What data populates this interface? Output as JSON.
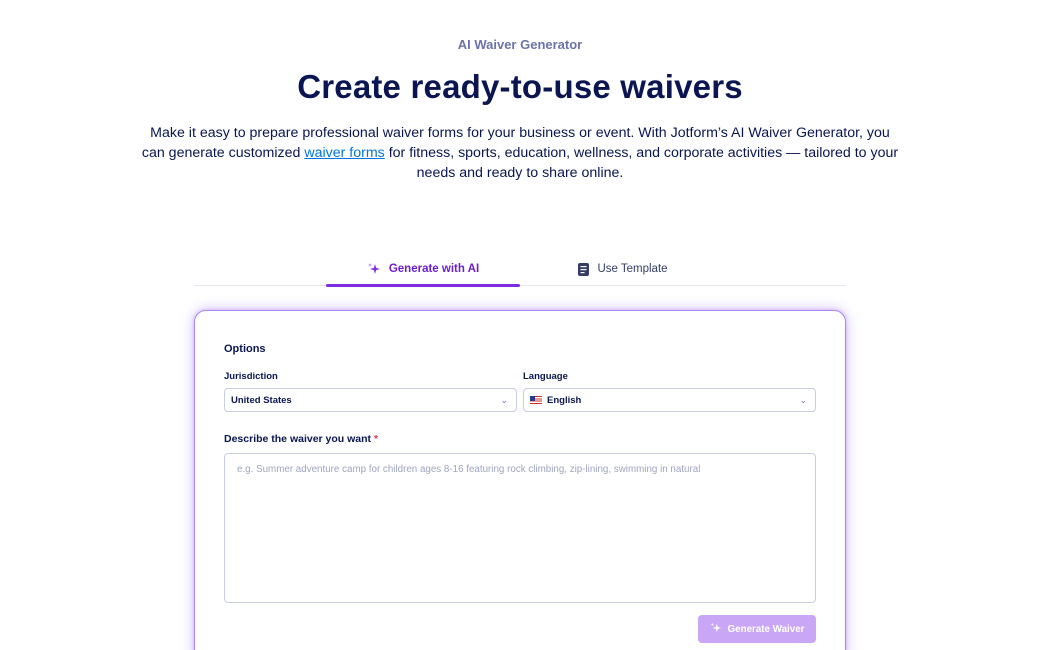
{
  "hero": {
    "eyebrow": "AI Waiver Generator",
    "title": "Create ready-to-use waivers",
    "desc_part1": "Make it easy to prepare professional waiver forms for your business or event. With Jotform’s AI Waiver Generator, you can generate customized ",
    "desc_link": "waiver forms",
    "desc_part2": " for fitness, sports, education, wellness, and corporate activities — tailored to your needs and ready to share online."
  },
  "tabs": [
    {
      "label": "Generate with AI",
      "icon": "sparkle-icon",
      "active": true
    },
    {
      "label": "Use Template",
      "icon": "document-icon",
      "active": false
    }
  ],
  "form": {
    "options_label": "Options",
    "jurisdiction_label": "Jurisdiction",
    "jurisdiction_value": "United States",
    "language_label": "Language",
    "language_value": "English",
    "language_flag": "us-flag-icon",
    "describe_label": "Describe the waiver you want",
    "required_mark": "*",
    "describe_placeholder": "e.g. Summer adventure camp for children ages 8-16 featuring rock climbing, zip-lining, swimming in natural",
    "generate_button": "Generate Waiver"
  },
  "colors": {
    "primary_text": "#0a1551",
    "accent_purple": "#7c2ee0",
    "link_blue": "#0075e3",
    "button_disabled": "#caa6f7",
    "required_red": "#e2364a"
  }
}
